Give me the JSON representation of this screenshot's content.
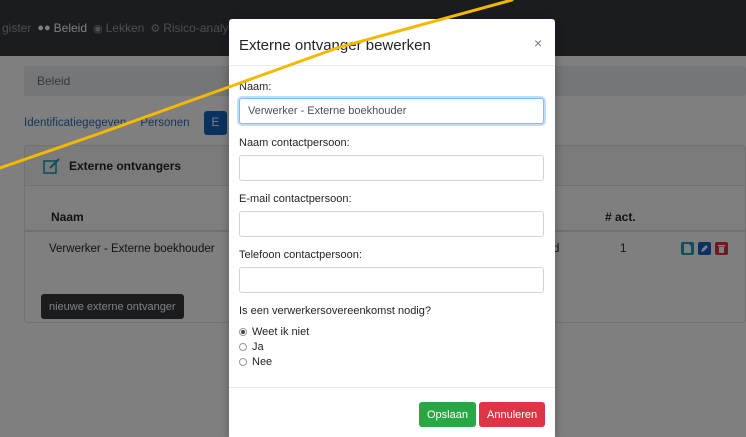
{
  "topnav": {
    "items": [
      {
        "label": "gister",
        "icon": ""
      },
      {
        "label": "Beleid",
        "icon": "users-icon"
      },
      {
        "label": "Lekken",
        "icon": "drop-icon"
      },
      {
        "label": "Risico-analys",
        "icon": "gear-icon"
      }
    ]
  },
  "breadcrumb": "Beleid",
  "tabs": [
    "Identificatiegegeven",
    "Personen",
    "E"
  ],
  "card": {
    "title": "Externe ontvangers",
    "columns": [
      "Naam",
      "# act."
    ],
    "rows": [
      {
        "name": "Verwerker - Externe boekhouder",
        "partial": "d",
        "count": "1"
      }
    ],
    "new_button": "nieuwe externe ontvanger"
  },
  "modal": {
    "title": "Externe ontvanger bewerken",
    "close": "×",
    "fields": {
      "naam": {
        "label": "Naam:",
        "value": "Verwerker - Externe boekhouder"
      },
      "contact_name": {
        "label": "Naam contactpersoon:",
        "value": ""
      },
      "contact_email": {
        "label": "E-mail contactpersoon:",
        "value": ""
      },
      "contact_phone": {
        "label": "Telefoon contactpersoon:",
        "value": ""
      }
    },
    "question": "Is een verwerkersovereenkomst nodig?",
    "options": [
      "Weet ik niet",
      "Ja",
      "Nee"
    ],
    "selected": "Weet ik niet",
    "save": "Opslaan",
    "cancel": "Annuleren"
  },
  "colors": {
    "navbar": "#343a40",
    "primary": "#1565c0",
    "success": "#28a745",
    "danger": "#dc3545",
    "annotation": "#f5b800"
  }
}
